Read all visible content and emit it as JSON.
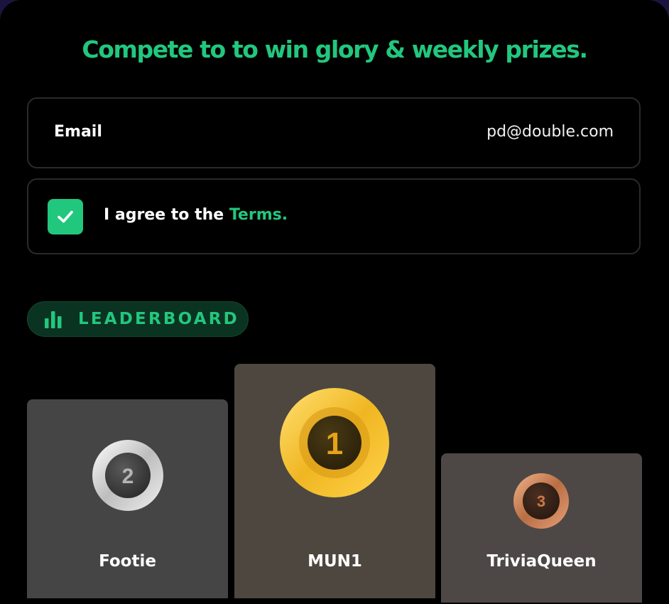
{
  "headline": "Compete to to win glory & weekly prizes.",
  "email": {
    "label": "Email",
    "value": "pd@double.com"
  },
  "terms": {
    "checked": true,
    "prefix": "I agree to the ",
    "link": "Terms."
  },
  "leaderboard": {
    "badge_label": "LEADERBOARD",
    "icon": "bar-chart-icon",
    "podium": [
      {
        "rank": "2",
        "name": "Footie",
        "medal": "silver"
      },
      {
        "rank": "1",
        "name": "MUN1",
        "medal": "gold"
      },
      {
        "rank": "3",
        "name": "TriviaQueen",
        "medal": "bronze"
      }
    ]
  },
  "colors": {
    "accent": "#22c77e",
    "background": "#000000",
    "badge_bg": "#0b3322",
    "gold": "#f2c232",
    "silver": "#d9d9d9",
    "bronze": "#c98455"
  }
}
